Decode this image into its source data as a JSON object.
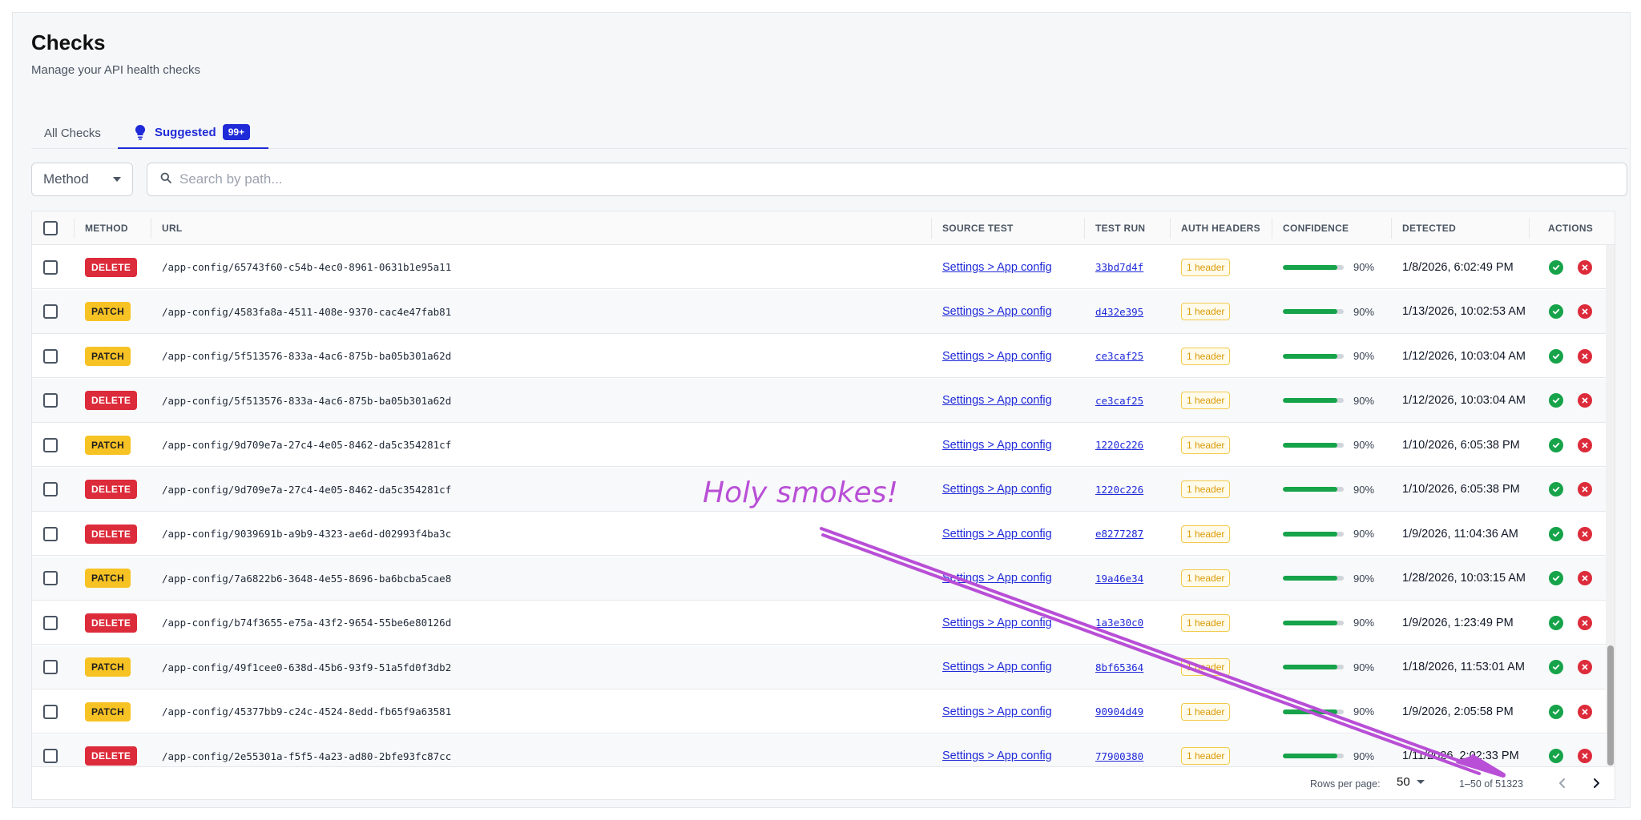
{
  "header": {
    "title": "Checks",
    "subtitle": "Manage your API health checks"
  },
  "tabs": {
    "all_label": "All Checks",
    "suggested_label": "Suggested",
    "suggested_badge": "99+"
  },
  "filters": {
    "method_label": "Method",
    "search_placeholder": "Search by path..."
  },
  "table": {
    "columns": {
      "method": "METHOD",
      "url": "URL",
      "source_test": "SOURCE TEST",
      "test_run": "TEST RUN",
      "auth_headers": "AUTH HEADERS",
      "confidence": "CONFIDENCE",
      "detected": "DETECTED",
      "actions": "ACTIONS"
    },
    "rows": [
      {
        "method": "DELETE",
        "url": "/app-config/65743f60-c54b-4ec0-8961-0631b1e95a11",
        "source_test": "Settings > App config",
        "test_run": "33bd7d4f",
        "auth_headers": "1 header",
        "confidence": "90%",
        "confidence_value": 0.9,
        "detected": "1/8/2026, 6:02:49 PM"
      },
      {
        "method": "PATCH",
        "url": "/app-config/4583fa8a-4511-408e-9370-cac4e47fab81",
        "source_test": "Settings > App config",
        "test_run": "d432e395",
        "auth_headers": "1 header",
        "confidence": "90%",
        "confidence_value": 0.9,
        "detected": "1/13/2026, 10:02:53 AM"
      },
      {
        "method": "PATCH",
        "url": "/app-config/5f513576-833a-4ac6-875b-ba05b301a62d",
        "source_test": "Settings > App config",
        "test_run": "ce3caf25",
        "auth_headers": "1 header",
        "confidence": "90%",
        "confidence_value": 0.9,
        "detected": "1/12/2026, 10:03:04 AM"
      },
      {
        "method": "DELETE",
        "url": "/app-config/5f513576-833a-4ac6-875b-ba05b301a62d",
        "source_test": "Settings > App config",
        "test_run": "ce3caf25",
        "auth_headers": "1 header",
        "confidence": "90%",
        "confidence_value": 0.9,
        "detected": "1/12/2026, 10:03:04 AM"
      },
      {
        "method": "PATCH",
        "url": "/app-config/9d709e7a-27c4-4e05-8462-da5c354281cf",
        "source_test": "Settings > App config",
        "test_run": "1220c226",
        "auth_headers": "1 header",
        "confidence": "90%",
        "confidence_value": 0.9,
        "detected": "1/10/2026, 6:05:38 PM"
      },
      {
        "method": "DELETE",
        "url": "/app-config/9d709e7a-27c4-4e05-8462-da5c354281cf",
        "source_test": "Settings > App config",
        "test_run": "1220c226",
        "auth_headers": "1 header",
        "confidence": "90%",
        "confidence_value": 0.9,
        "detected": "1/10/2026, 6:05:38 PM"
      },
      {
        "method": "DELETE",
        "url": "/app-config/9039691b-a9b9-4323-ae6d-d02993f4ba3c",
        "source_test": "Settings > App config",
        "test_run": "e8277287",
        "auth_headers": "1 header",
        "confidence": "90%",
        "confidence_value": 0.9,
        "detected": "1/9/2026, 11:04:36 AM"
      },
      {
        "method": "PATCH",
        "url": "/app-config/7a6822b6-3648-4e55-8696-ba6bcba5cae8",
        "source_test": "Settings > App config",
        "test_run": "19a46e34",
        "auth_headers": "1 header",
        "confidence": "90%",
        "confidence_value": 0.9,
        "detected": "1/28/2026, 10:03:15 AM"
      },
      {
        "method": "DELETE",
        "url": "/app-config/b74f3655-e75a-43f2-9654-55be6e80126d",
        "source_test": "Settings > App config",
        "test_run": "1a3e30c0",
        "auth_headers": "1 header",
        "confidence": "90%",
        "confidence_value": 0.9,
        "detected": "1/9/2026, 1:23:49 PM"
      },
      {
        "method": "PATCH",
        "url": "/app-config/49f1cee0-638d-45b6-93f9-51a5fd0f3db2",
        "source_test": "Settings > App config",
        "test_run": "8bf65364",
        "auth_headers": "1 header",
        "confidence": "90%",
        "confidence_value": 0.9,
        "detected": "1/18/2026, 11:53:01 AM"
      },
      {
        "method": "PATCH",
        "url": "/app-config/45377bb9-c24c-4524-8edd-fb65f9a63581",
        "source_test": "Settings > App config",
        "test_run": "90904d49",
        "auth_headers": "1 header",
        "confidence": "90%",
        "confidence_value": 0.9,
        "detected": "1/9/2026, 2:05:58 PM"
      },
      {
        "method": "DELETE",
        "url": "/app-config/2e55301a-f5f5-4a23-ad80-2bfe93fc87cc",
        "source_test": "Settings > App config",
        "test_run": "77900380",
        "auth_headers": "1 header",
        "confidence": "90%",
        "confidence_value": 0.9,
        "detected": "1/11/2026, 2:02:33 PM"
      }
    ]
  },
  "pagination": {
    "rows_per_page_label": "Rows per page:",
    "rows_per_page_value": "50",
    "range": "1–50 of 51323"
  },
  "annotation": {
    "text": "Holy smokes!",
    "color": "#b84fd6"
  },
  "colors": {
    "accent": "#1f2ad8",
    "delete": "#dc2b3a",
    "patch": "#f7c224",
    "success": "#16a34a"
  }
}
